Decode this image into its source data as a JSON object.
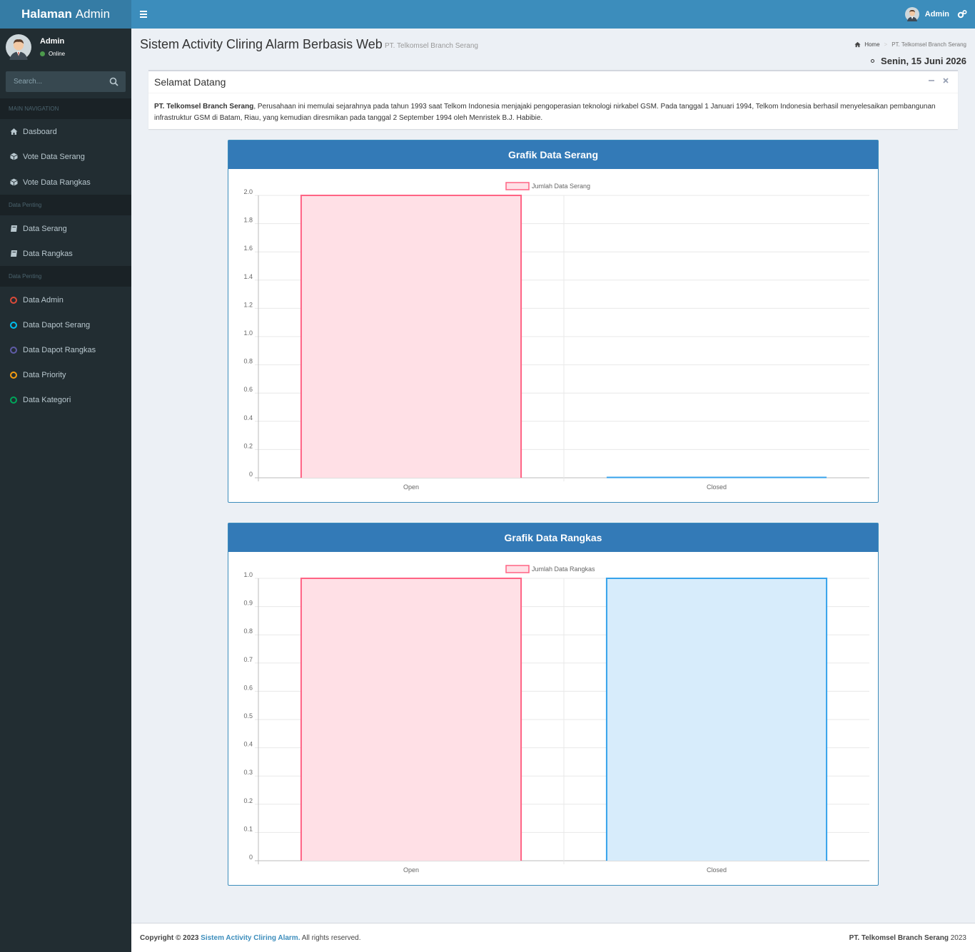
{
  "header": {
    "logo_bold": "Halaman",
    "logo_rest": "Admin",
    "user_name": "Admin"
  },
  "sidebar": {
    "user_name": "Admin",
    "user_status": "Online",
    "search_placeholder": "Search...",
    "sections": [
      "MAIN NAVIGATION",
      "Data Penting",
      "Data Penting"
    ],
    "items": [
      {
        "label": "Dasboard",
        "icon": "home-icon"
      },
      {
        "label": "Vote Data Serang",
        "icon": "cube-icon"
      },
      {
        "label": "Vote Data Rangkas",
        "icon": "cube-icon"
      },
      {
        "label": "Data Serang",
        "icon": "book-icon"
      },
      {
        "label": "Data Rangkas",
        "icon": "book-icon"
      },
      {
        "label": "Data Admin",
        "icon": "circle-icon",
        "color": "#dd4b39"
      },
      {
        "label": "Data Dapot Serang",
        "icon": "circle-icon",
        "color": "#00c0ef"
      },
      {
        "label": "Data Dapot Rangkas",
        "icon": "circle-icon",
        "color": "#605ca8"
      },
      {
        "label": "Data Priority",
        "icon": "circle-icon",
        "color": "#f39c12"
      },
      {
        "label": "Data Kategori",
        "icon": "circle-icon",
        "color": "#00a65a"
      }
    ]
  },
  "page": {
    "title": "Sistem Activity Cliring Alarm Berbasis Web",
    "subtitle": "PT. Telkomsel Branch Serang",
    "breadcrumb_home": "Home",
    "breadcrumb_current": "PT. Telkomsel Branch Serang",
    "date": "Senin, 15 Juni 2026"
  },
  "welcome": {
    "title": "Selamat Datang",
    "company": "PT. Telkomsel Branch Serang",
    "text": ", Perusahaan ini memulai sejarahnya pada tahun 1993 saat Telkom Indonesia menjajaki pengoperasian teknologi nirkabel GSM. Pada tanggal 1 Januari 1994, Telkom Indonesia berhasil menyelesaikan pembangunan infrastruktur GSM di Batam, Riau, yang kemudian diresmikan pada tanggal 2 September 1994 oleh Menristek B.J. Habibie."
  },
  "footer": {
    "copyright": "Copyright © 2023",
    "link": "Sistem Activity Cliring Alarm.",
    "rights": "All rights reserved.",
    "right_bold": "PT. Telkomsel Branch Serang",
    "right_year": "2023"
  },
  "colors": {
    "pink_fill": "#ffe0e6",
    "pink_line": "#ff6384",
    "blue_fill": "#d7ecfb",
    "blue_line": "#36a2eb"
  },
  "chart_data": [
    {
      "type": "bar",
      "title": "Grafik Data Serang",
      "categories": [
        "Open",
        "Closed"
      ],
      "series": [
        {
          "name": "Jumlah Data Serang",
          "values": [
            2,
            0
          ]
        }
      ],
      "ylim": [
        0,
        2.0
      ],
      "yticks": [
        "0",
        "0.2",
        "0.4",
        "0.6",
        "0.8",
        "1.0",
        "1.2",
        "1.4",
        "1.6",
        "1.8",
        "2.0"
      ],
      "grid": true,
      "legend": "top-center"
    },
    {
      "type": "bar",
      "title": "Grafik Data Rangkas",
      "categories": [
        "Open",
        "Closed"
      ],
      "series": [
        {
          "name": "Jumlah Data Rangkas",
          "values": [
            1,
            1
          ]
        }
      ],
      "ylim": [
        0,
        1.0
      ],
      "yticks": [
        "0",
        "0.1",
        "0.2",
        "0.3",
        "0.4",
        "0.5",
        "0.6",
        "0.7",
        "0.8",
        "0.9",
        "1.0"
      ],
      "grid": true,
      "legend": "top-center"
    }
  ]
}
